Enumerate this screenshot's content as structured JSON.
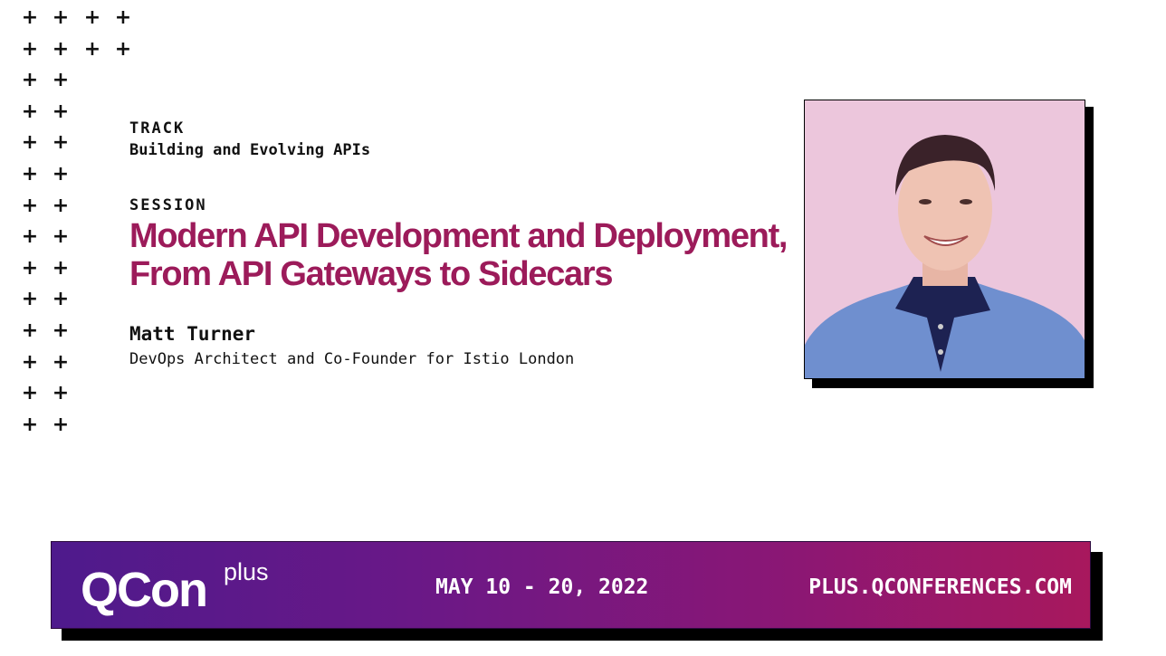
{
  "decoration": {
    "plus_glyph": "+"
  },
  "track": {
    "label": "TRACK",
    "name": "Building and Evolving APIs"
  },
  "session": {
    "label": "SESSION",
    "title_line1": "Modern API Development and Deployment,",
    "title_line2": "From API Gateways to Sidecars"
  },
  "speaker": {
    "name": "Matt Turner",
    "role": "DevOps Architect and Co-Founder for Istio London",
    "photo_alt": "Speaker photo"
  },
  "banner": {
    "logo": "QCon",
    "logo_suffix": "plus",
    "dates": "MAY 10 - 20, 2022",
    "url": "PLUS.QCONFERENCES.COM"
  },
  "colors": {
    "title": "#9c1b5a",
    "banner_start": "#4e1a8c",
    "banner_end": "#a8185d",
    "photo_bg": "#ecc6dc"
  }
}
